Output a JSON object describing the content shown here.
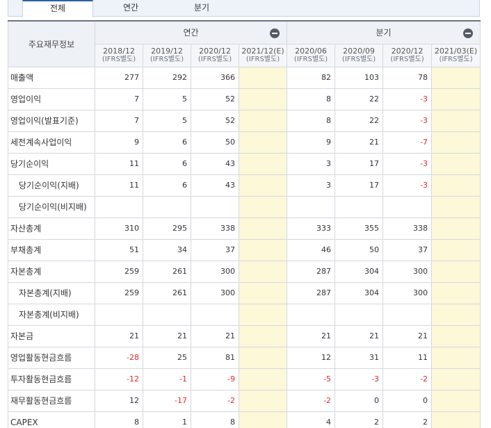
{
  "tabs": [
    {
      "label": "전체"
    },
    {
      "label": "연간"
    },
    {
      "label": "분기"
    }
  ],
  "table": {
    "corner_label": "주요재무정보",
    "group_annual": "연간",
    "group_quarter": "분기",
    "basis": "(IFRS별도)",
    "periods": [
      "2018/12",
      "2019/12",
      "2020/12",
      "2021/12(E)",
      "2020/06",
      "2020/09",
      "2020/12",
      "2021/03(E)"
    ],
    "rows": [
      {
        "label": "매출액",
        "values": [
          "277",
          "292",
          "366",
          "",
          "82",
          "103",
          "78",
          ""
        ]
      },
      {
        "label": "영업이익",
        "values": [
          "7",
          "5",
          "52",
          "",
          "8",
          "22",
          "-3",
          ""
        ]
      },
      {
        "label": "영업이익(발표기준)",
        "values": [
          "7",
          "5",
          "52",
          "",
          "8",
          "22",
          "-3",
          ""
        ]
      },
      {
        "label": "세전계속사업이익",
        "values": [
          "9",
          "6",
          "50",
          "",
          "9",
          "21",
          "-7",
          ""
        ]
      },
      {
        "label": "당기순이익",
        "values": [
          "11",
          "6",
          "43",
          "",
          "3",
          "17",
          "-3",
          ""
        ]
      },
      {
        "label": "당기순이익(지배)",
        "values": [
          "11",
          "6",
          "43",
          "",
          "3",
          "17",
          "-3",
          ""
        ]
      },
      {
        "label": "당기순이익(비지배)",
        "values": [
          "",
          "",
          "",
          "",
          "",
          "",
          "",
          ""
        ]
      },
      {
        "label": "자산총계",
        "values": [
          "310",
          "295",
          "338",
          "",
          "333",
          "355",
          "338",
          ""
        ]
      },
      {
        "label": "부채총계",
        "values": [
          "51",
          "34",
          "37",
          "",
          "46",
          "50",
          "37",
          ""
        ]
      },
      {
        "label": "자본총계",
        "values": [
          "259",
          "261",
          "300",
          "",
          "287",
          "304",
          "300",
          ""
        ]
      },
      {
        "label": "자본총계(지배)",
        "values": [
          "259",
          "261",
          "300",
          "",
          "287",
          "304",
          "300",
          ""
        ]
      },
      {
        "label": "자본총계(비지배)",
        "values": [
          "",
          "",
          "",
          "",
          "",
          "",
          "",
          ""
        ]
      },
      {
        "label": "자본금",
        "values": [
          "21",
          "21",
          "21",
          "",
          "21",
          "21",
          "21",
          ""
        ]
      },
      {
        "label": "영업활동현금흐름",
        "values": [
          "-28",
          "25",
          "81",
          "",
          "12",
          "31",
          "11",
          ""
        ]
      },
      {
        "label": "투자활동현금흐름",
        "values": [
          "-12",
          "-1",
          "-9",
          "",
          "-5",
          "-3",
          "-2",
          ""
        ]
      },
      {
        "label": "재무활동현금흐름",
        "values": [
          "12",
          "-17",
          "-2",
          "",
          "-2",
          "0",
          "0",
          ""
        ]
      },
      {
        "label": "CAPEX",
        "values": [
          "8",
          "1",
          "8",
          "",
          "4",
          "2",
          "2",
          ""
        ]
      }
    ]
  },
  "colors": {
    "negative": "#e02b27",
    "forecast_bg": "#fcf8d8",
    "header_bg": "#eef1f6",
    "active_tab_border": "#2e5ea8"
  },
  "icons": {
    "collapse_annual": "minus-circle-icon",
    "collapse_quarter": "minus-circle-icon"
  }
}
